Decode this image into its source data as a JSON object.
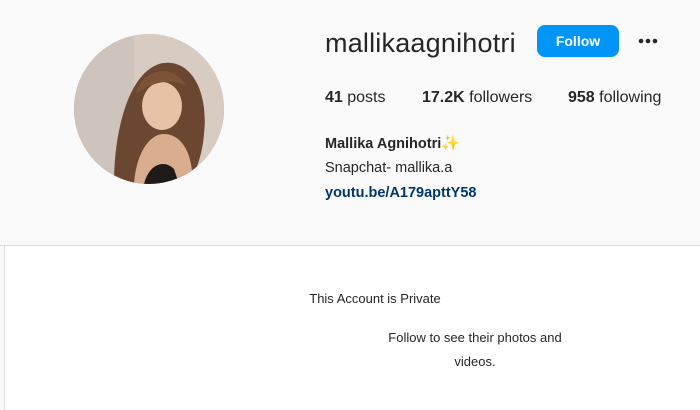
{
  "profile": {
    "username": "mallikaagnihotri",
    "follow_label": "Follow",
    "more_icon": "more-horizontal-icon",
    "stats": {
      "posts_count": "41",
      "posts_label": "posts",
      "followers_count": "17.2K",
      "followers_label": "followers",
      "following_count": "958",
      "following_label": "following"
    },
    "full_name": "Mallika Agnihotri",
    "name_emoji": "✨",
    "bio_line": "Snapchat- mallika.a",
    "link": "youtu.be/A179apttY58"
  },
  "private_notice": {
    "title": "This Account is Private",
    "message": "Follow to see their photos and videos."
  },
  "colors": {
    "follow_button": "#0095f6",
    "link": "#00376b",
    "background": "#fafafa"
  }
}
